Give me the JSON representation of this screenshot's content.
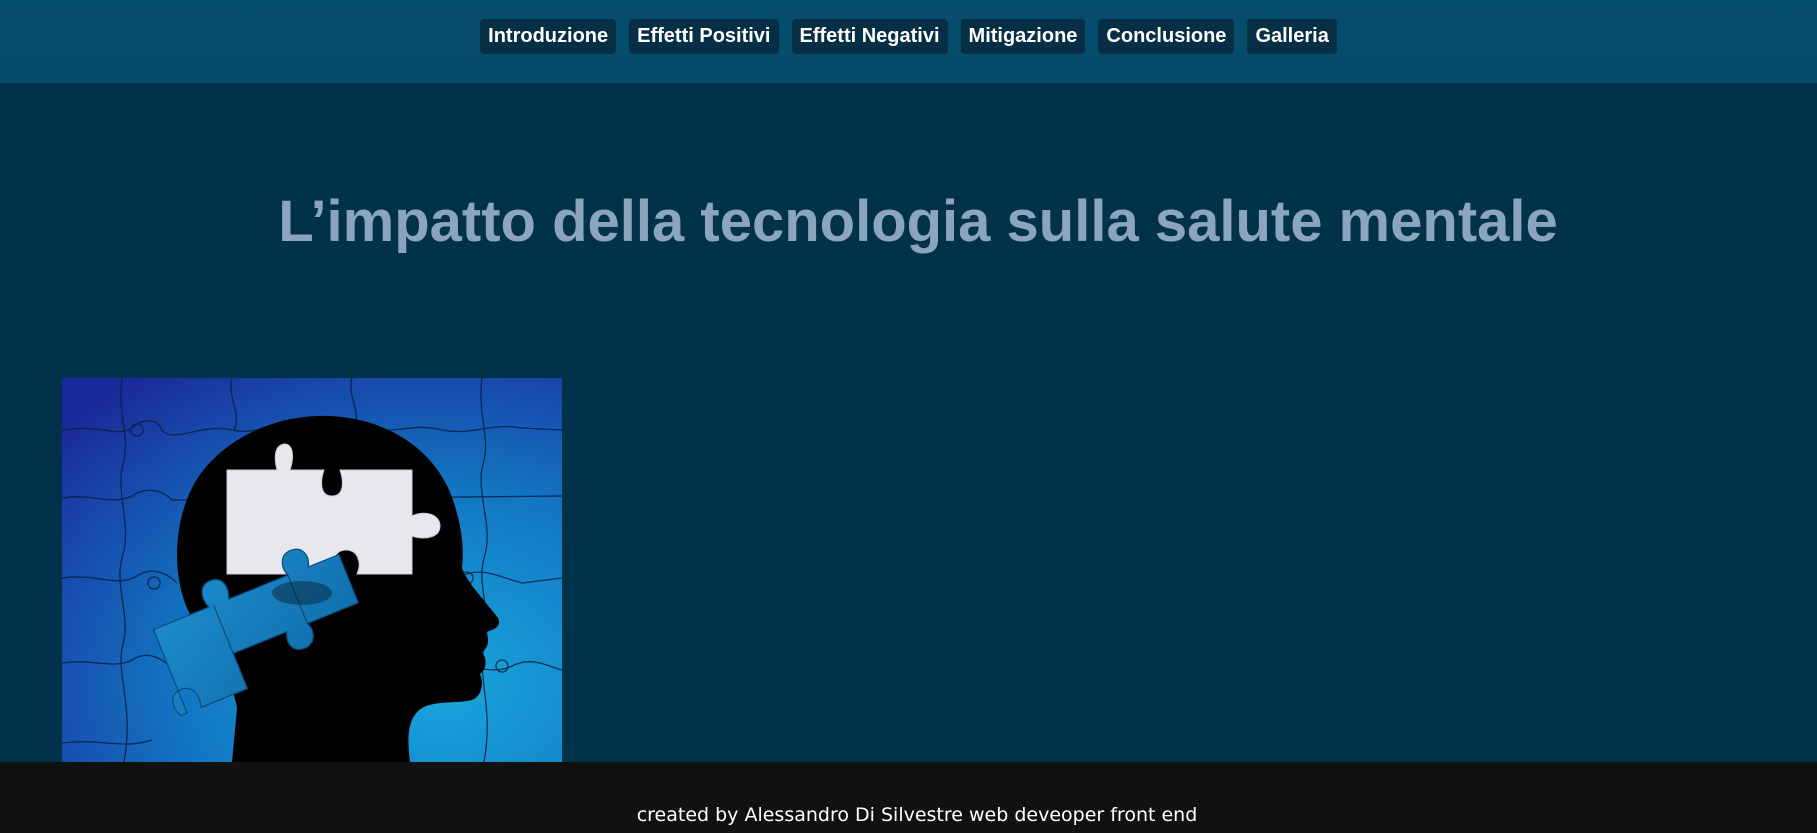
{
  "nav": {
    "items": [
      {
        "label": "Introduzione"
      },
      {
        "label": "Effetti Positivi"
      },
      {
        "label": "Effetti Negativi"
      },
      {
        "label": "Mitigazione"
      },
      {
        "label": "Conclusione"
      },
      {
        "label": "Galleria"
      }
    ]
  },
  "hero": {
    "title": "L’impatto della tecnologia sulla salute mentale"
  },
  "image": {
    "icon": "head-puzzle-illustration"
  },
  "footer": {
    "credit": "created by Alessandro Di Silvestre web deveoper front end"
  },
  "colors": {
    "background": "#00324a",
    "topbar": "#054a69",
    "nav_button": "#062f45",
    "title": "#8ba5bf",
    "footer": "#111111"
  }
}
